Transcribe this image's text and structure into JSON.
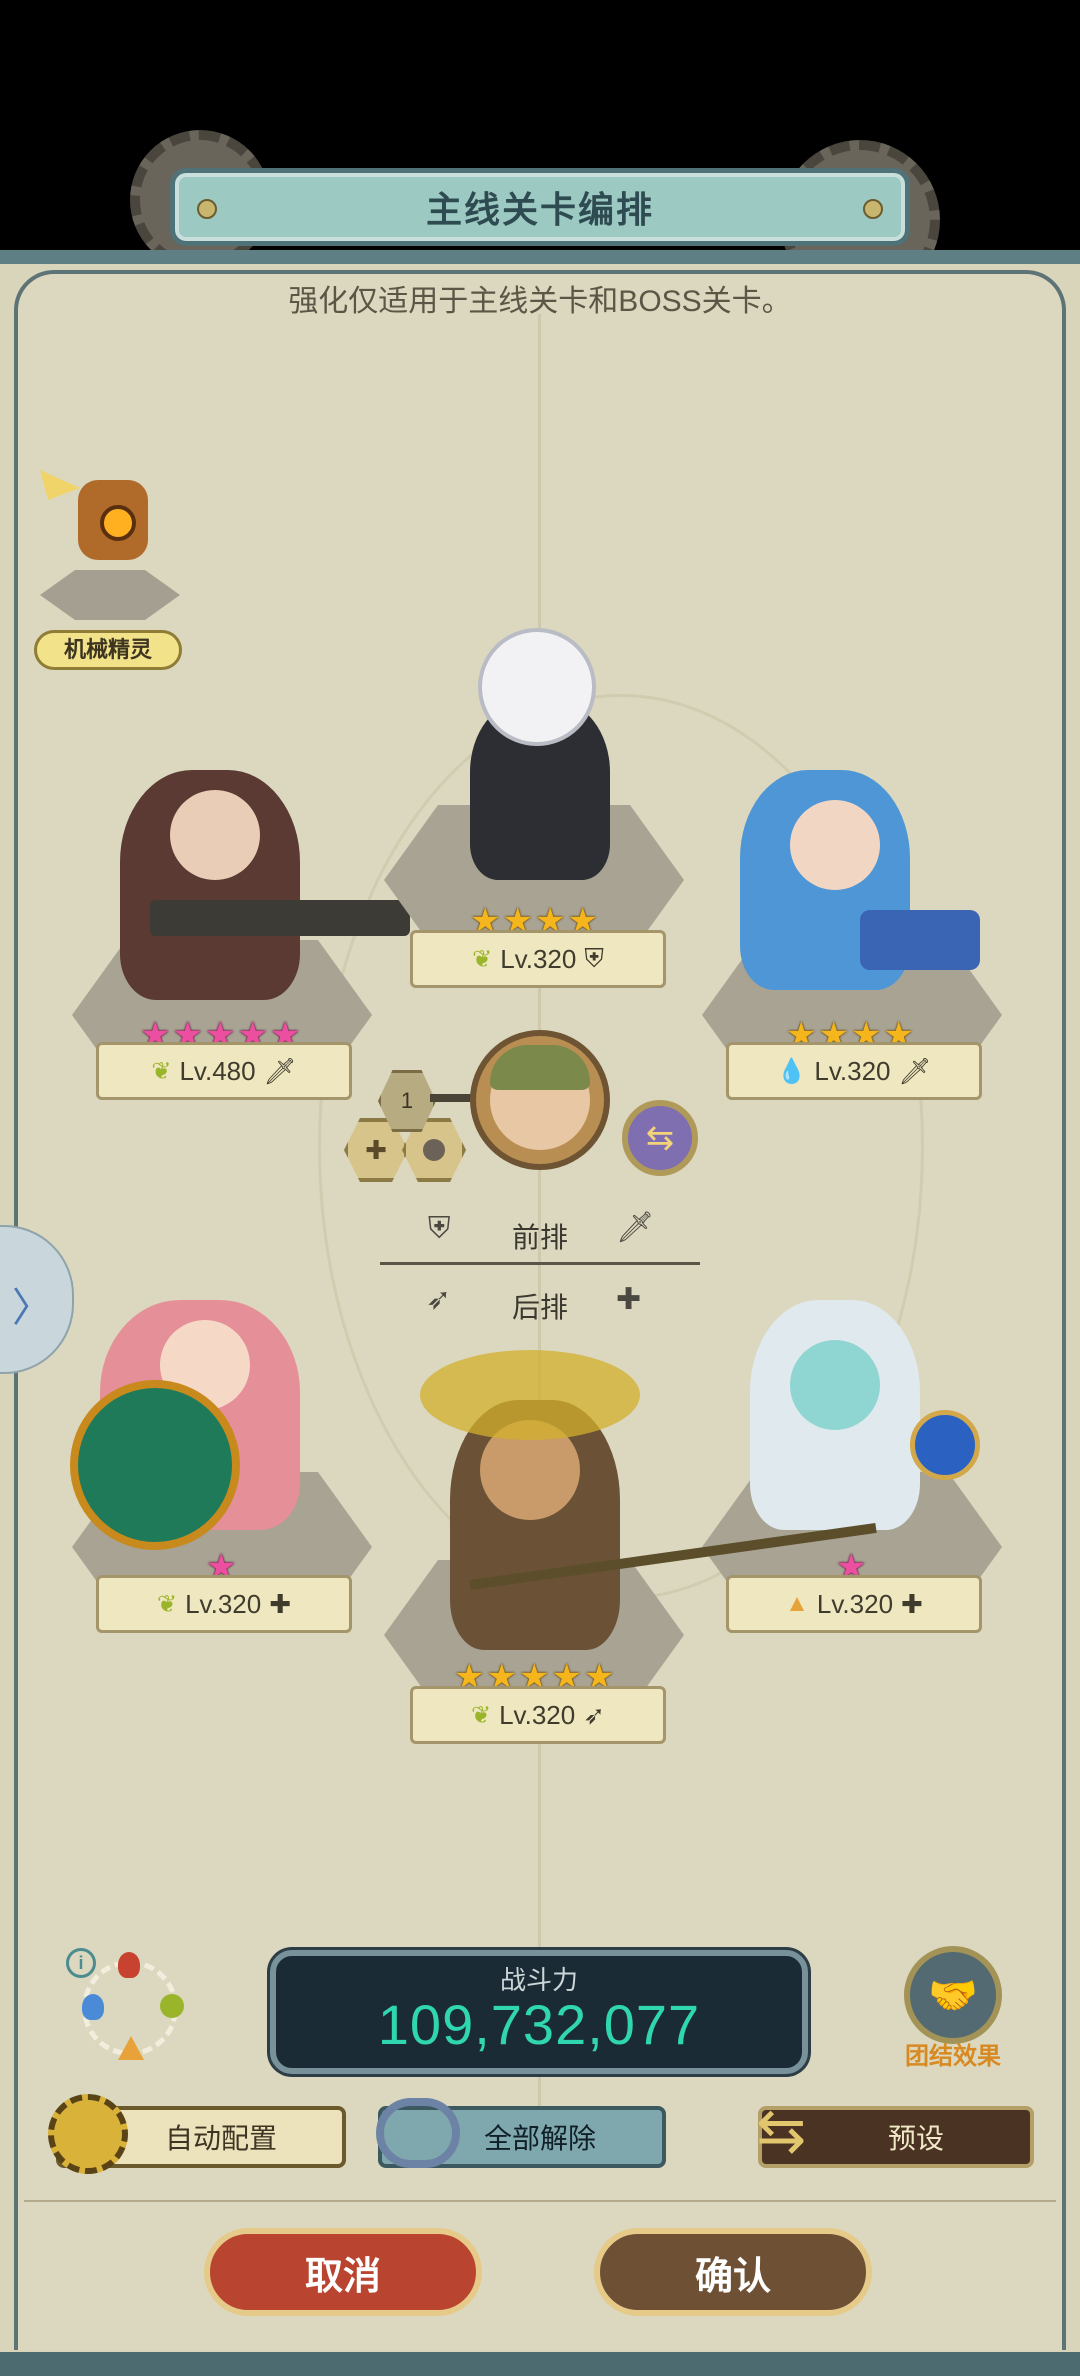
{
  "header": {
    "title": "主线关卡编排",
    "subtitle": "强化仅适用于主线关卡和BOSS关卡。"
  },
  "spirit": {
    "label": "机械精灵",
    "icon": "mech-spirit-icon"
  },
  "heroes": {
    "front_left": {
      "level": "Lv.480",
      "stars": 5,
      "star_color": "pink",
      "element": "wind",
      "role": "dps"
    },
    "front_center": {
      "level": "Lv.320",
      "stars": 4,
      "star_color": "gold",
      "element": "wind",
      "role": "tank"
    },
    "front_right": {
      "level": "Lv.320",
      "stars": 4,
      "star_color": "gold",
      "element": "water",
      "role": "dps"
    },
    "back_left": {
      "level": "Lv.320",
      "stars": 1,
      "star_color": "pink",
      "element": "wind",
      "role": "healer"
    },
    "back_center": {
      "level": "Lv.320",
      "stars": 5,
      "star_color": "gold",
      "element": "wind",
      "role": "archer"
    },
    "back_right": {
      "level": "Lv.320",
      "stars": 1,
      "star_color": "pink",
      "element": "earth",
      "role": "healer"
    }
  },
  "leader": {
    "level_badge": "1"
  },
  "rows": {
    "front_label": "前排",
    "back_label": "后排"
  },
  "power": {
    "label": "战斗力",
    "value": "109,732,077"
  },
  "unity": {
    "label": "团结效果"
  },
  "buttons": {
    "auto": "自动配置",
    "clear": "全部解除",
    "preset": "预设",
    "cancel": "取消",
    "confirm": "确认"
  },
  "colors": {
    "power_value": "#2fd6b0",
    "unity_label": "#d88a22",
    "panel": "#dcd8bf"
  },
  "glyphs": {
    "star": "★",
    "plus": "✚",
    "chevron": "〉",
    "swap": "⇆",
    "info": "i",
    "shield": "⛨",
    "sword": "🗡",
    "bow": "➶",
    "wind": "❦",
    "water": "💧",
    "earth": "▲"
  }
}
